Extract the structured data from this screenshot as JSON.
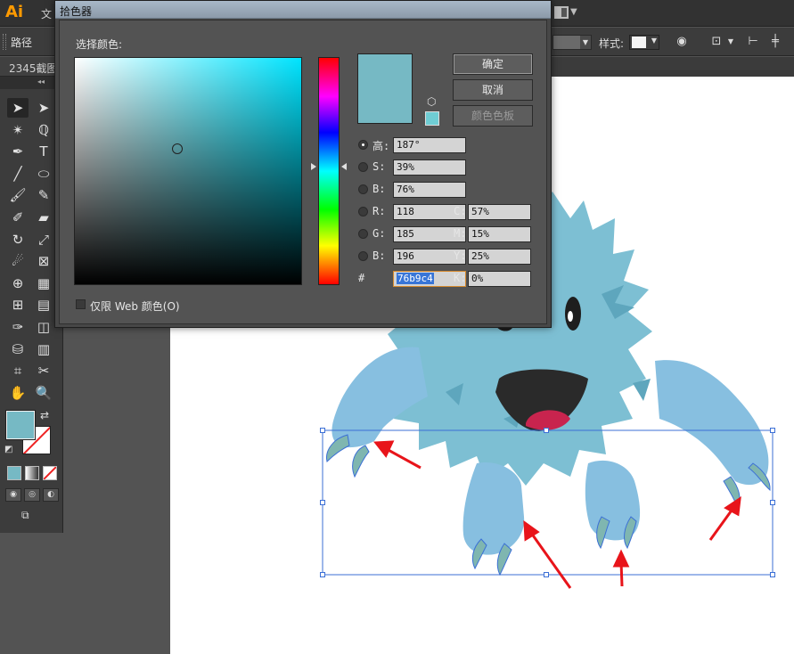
{
  "app": {
    "logo": "Ai",
    "menu_partial": "文"
  },
  "control_bar": {
    "path_label": "路径",
    "style_label": "样式:"
  },
  "document_tab": {
    "label": "2345截图"
  },
  "toolbar": {
    "header_collapse": "◂◂",
    "tools": [
      {
        "icon": "selection-tool-icon",
        "glyph": "➤"
      },
      {
        "icon": "direct-selection-tool-icon",
        "glyph": "➤"
      },
      {
        "icon": "magic-wand-tool-icon",
        "glyph": "✴"
      },
      {
        "icon": "lasso-tool-icon",
        "glyph": "ℚ"
      },
      {
        "icon": "pen-tool-icon",
        "glyph": "✒"
      },
      {
        "icon": "type-tool-icon",
        "glyph": "T"
      },
      {
        "icon": "line-tool-icon",
        "glyph": "╱"
      },
      {
        "icon": "ellipse-tool-icon",
        "glyph": "⬭"
      },
      {
        "icon": "paintbrush-tool-icon",
        "glyph": "🖌"
      },
      {
        "icon": "pencil-tool-icon",
        "glyph": "✎"
      },
      {
        "icon": "blob-brush-tool-icon",
        "glyph": "✐"
      },
      {
        "icon": "eraser-tool-icon",
        "glyph": "▰"
      },
      {
        "icon": "rotate-tool-icon",
        "glyph": "↻"
      },
      {
        "icon": "scale-tool-icon",
        "glyph": "⤢"
      },
      {
        "icon": "warp-tool-icon",
        "glyph": "☄"
      },
      {
        "icon": "free-transform-tool-icon",
        "glyph": "⊠"
      },
      {
        "icon": "shape-builder-tool-icon",
        "glyph": "⊕"
      },
      {
        "icon": "perspective-grid-tool-icon",
        "glyph": "▦"
      },
      {
        "icon": "mesh-tool-icon",
        "glyph": "⊞"
      },
      {
        "icon": "gradient-tool-icon",
        "glyph": "▤"
      },
      {
        "icon": "eyedropper-tool-icon",
        "glyph": "✑"
      },
      {
        "icon": "blend-tool-icon",
        "glyph": "◫"
      },
      {
        "icon": "symbol-sprayer-tool-icon",
        "glyph": "⛁"
      },
      {
        "icon": "column-graph-tool-icon",
        "glyph": "▥"
      },
      {
        "icon": "artboard-tool-icon",
        "glyph": "⌗"
      },
      {
        "icon": "slice-tool-icon",
        "glyph": "✂"
      },
      {
        "icon": "hand-tool-icon",
        "glyph": "✋"
      },
      {
        "icon": "zoom-tool-icon",
        "glyph": "🔍"
      }
    ],
    "fill_color": "#76b9c4"
  },
  "color_picker": {
    "title": "拾色器",
    "select_label": "选择颜色:",
    "ok_label": "确定",
    "cancel_label": "取消",
    "swatches_label": "颜色色板",
    "hsb": [
      {
        "label": "高:",
        "value": "187°",
        "checked": true
      },
      {
        "label": "S:",
        "value": "39%",
        "checked": false
      },
      {
        "label": "B:",
        "value": "76%",
        "checked": false
      }
    ],
    "rgb": [
      {
        "label": "R:",
        "value": "118"
      },
      {
        "label": "G:",
        "value": "185"
      },
      {
        "label": "B:",
        "value": "196"
      }
    ],
    "cmyk": [
      {
        "label": "C:",
        "value": "57%"
      },
      {
        "label": "M:",
        "value": "15%"
      },
      {
        "label": "Y:",
        "value": "25%"
      },
      {
        "label": "K:",
        "value": "0%"
      }
    ],
    "hex_label": "#",
    "hex_value": "76b9c4",
    "web_only_label": "仅限 Web 颜色(O)",
    "new_color": "#76b9c4"
  },
  "artwork": {
    "body_color": "#7dbfd3",
    "limb_color": "#87bfe0",
    "claw_color": "#7fb6b0",
    "mouth_color": "#2a2a2a",
    "tongue_color": "#c8244e",
    "arrow_color": "#e8141a",
    "selection_color": "#3b6fd6"
  }
}
